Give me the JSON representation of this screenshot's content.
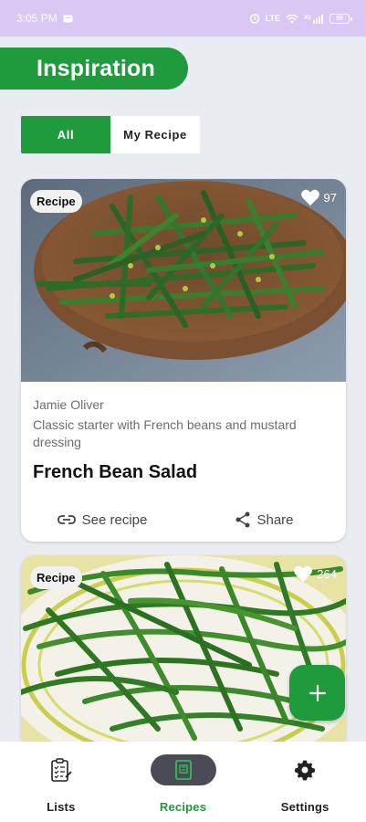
{
  "status_bar": {
    "time": "3:05 PM",
    "signal_small_top": "LTE",
    "network": "4G",
    "battery": "59"
  },
  "header": {
    "title": "Inspiration"
  },
  "segments": {
    "all": "All",
    "my_recipe": "My Recipe"
  },
  "cards": [
    {
      "tag": "Recipe",
      "likes": "97",
      "author": "Jamie Oliver",
      "description": "Classic starter with French beans and mustard dressing",
      "title": "French Bean Salad",
      "see_recipe": "See recipe",
      "share": "Share"
    },
    {
      "tag": "Recipe",
      "likes": "264"
    }
  ],
  "fab": {
    "icon": "plus-icon"
  },
  "bottom_nav": {
    "lists": "Lists",
    "recipes": "Recipes",
    "settings": "Settings"
  },
  "colors": {
    "accent": "#1f9a3c",
    "status_bar": "#d9c8f4",
    "background": "#e9edf1"
  }
}
